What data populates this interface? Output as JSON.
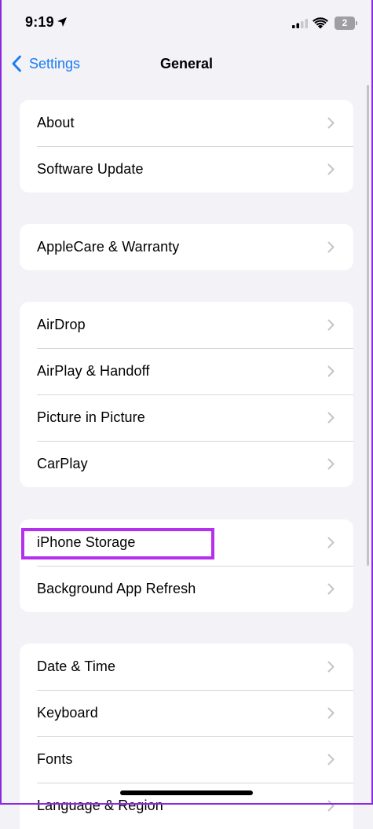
{
  "status_bar": {
    "time": "9:19",
    "battery_level": "2",
    "icons": [
      "location-arrow-icon",
      "signal-icon",
      "wifi-icon",
      "battery-icon"
    ]
  },
  "nav": {
    "back_label": "Settings",
    "title": "General"
  },
  "groups": [
    {
      "items": [
        "About",
        "Software Update"
      ]
    },
    {
      "items": [
        "AppleCare & Warranty"
      ]
    },
    {
      "items": [
        "AirDrop",
        "AirPlay & Handoff",
        "Picture in Picture",
        "CarPlay"
      ]
    },
    {
      "items": [
        "iPhone Storage",
        "Background App Refresh"
      ]
    },
    {
      "items": [
        "Date & Time",
        "Keyboard",
        "Fonts",
        "Language & Region"
      ]
    }
  ],
  "highlighted_item": "iPhone Storage",
  "colors": {
    "accent": "#1a7bf2",
    "highlight": "#b52ff0",
    "background": "#f2f2f7",
    "frame": "#8a2be2"
  }
}
